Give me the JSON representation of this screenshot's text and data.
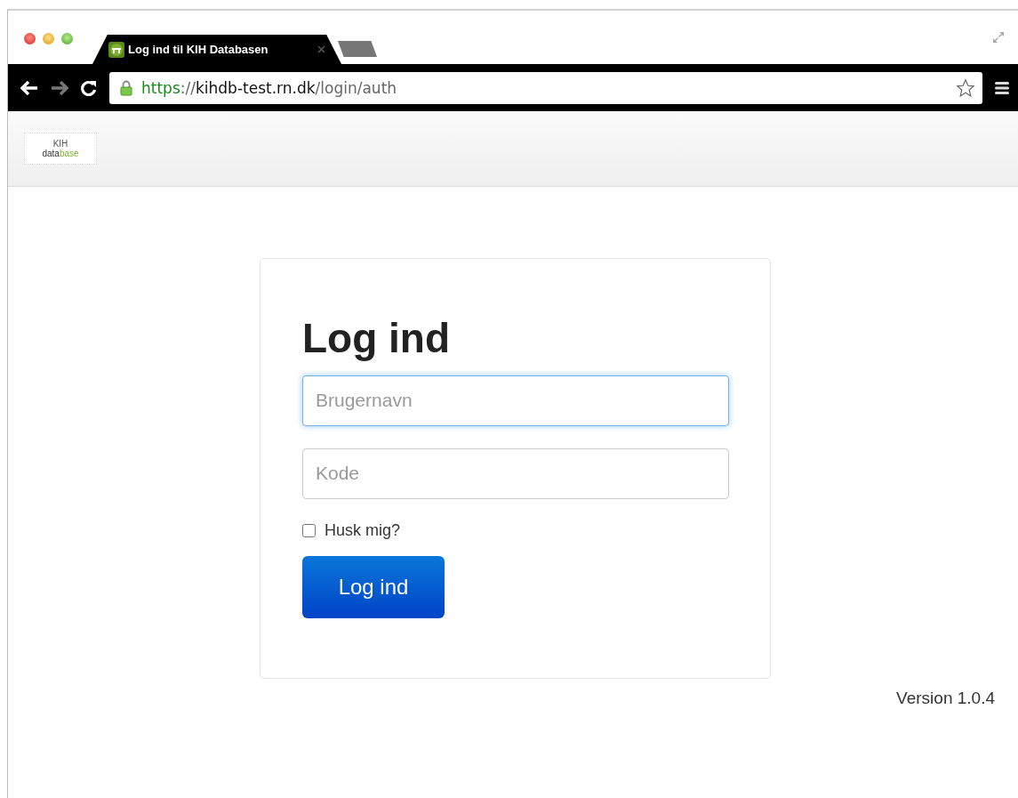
{
  "browser": {
    "tabs": [
      {
        "title": "Log ind til KIH Databasen",
        "selected": true
      },
      {
        "selected": false
      }
    ],
    "url": {
      "scheme": "https",
      "separator": "://",
      "host": "kihdb-test.rn.dk",
      "path": "/login/auth"
    }
  },
  "header": {
    "logo": {
      "top": "KIH",
      "bottom_a": "data",
      "bottom_b": "base"
    }
  },
  "login": {
    "title": "Log ind",
    "fields": [
      {
        "placeholder": "Brugernavn",
        "focused": true
      },
      {
        "placeholder": "Kode",
        "focused": false
      }
    ],
    "remember": {
      "label": "Husk mig?",
      "checked": false
    },
    "submit": "Log ind"
  },
  "version": "Version 1.0.4"
}
